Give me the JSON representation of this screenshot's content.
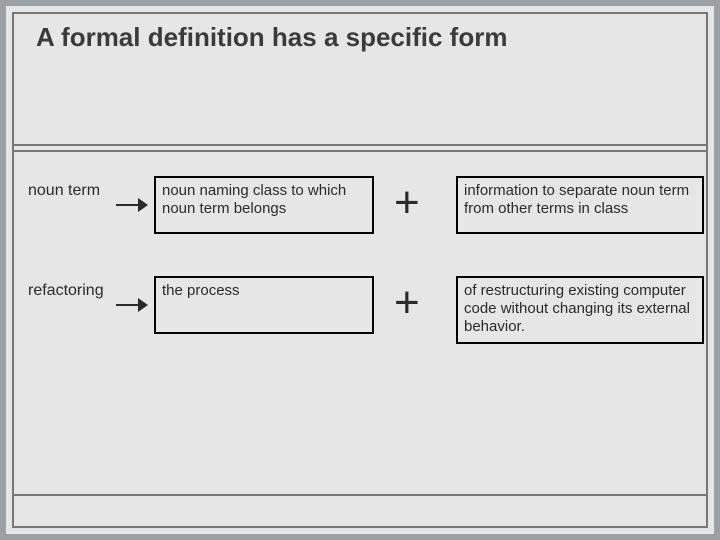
{
  "title": "A formal definition has a specific form",
  "rows": [
    {
      "term": "noun term",
      "class_box": "noun naming class to which noun term belongs",
      "plus": "+",
      "diff_box": "information to separate noun term from other terms in class"
    },
    {
      "term": "refactoring",
      "class_box": "the process",
      "plus": "+",
      "diff_box": "of restructuring existing computer code without changing its external behavior."
    }
  ]
}
